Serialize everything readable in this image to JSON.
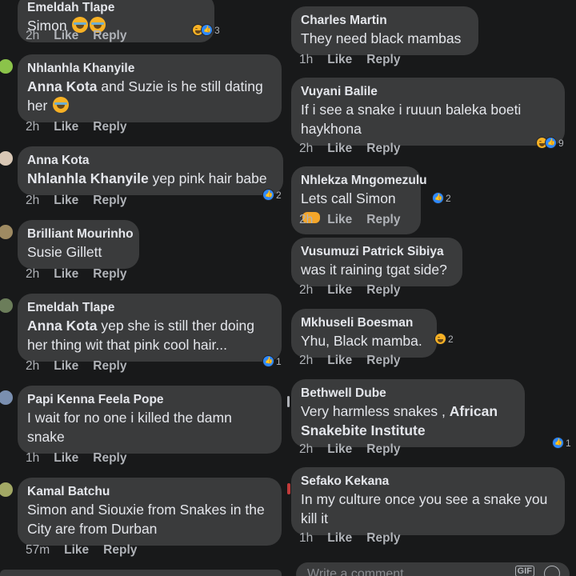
{
  "left": [
    {
      "author": "Emeldah Tlape",
      "segments": [
        {
          "t": "Simon ",
          "m": false
        }
      ],
      "emoji": "😂😂",
      "time": "2h",
      "like": "Like",
      "reply": "Reply",
      "react_count": "3",
      "react_types": [
        "haha",
        "like"
      ]
    },
    {
      "author": "Nhlanhla Khanyile",
      "segments": [
        {
          "t": "Anna Kota",
          "m": true
        },
        {
          "t": " and Suzie is he still dating her ",
          "m": false
        }
      ],
      "emoji": "😂",
      "time": "2h",
      "like": "Like",
      "reply": "Reply"
    },
    {
      "author": "Anna Kota",
      "segments": [
        {
          "t": "Nhlanhla Khanyile",
          "m": true
        },
        {
          "t": " yep pink hair babe",
          "m": false
        }
      ],
      "time": "2h",
      "like": "Like",
      "reply": "Reply",
      "react_count": "2",
      "react_types": [
        "like"
      ]
    },
    {
      "author": "Brilliant Mourinho",
      "segments": [
        {
          "t": "Susie Gillett",
          "m": false
        }
      ],
      "time": "2h",
      "like": "Like",
      "reply": "Reply"
    },
    {
      "author": "Emeldah Tlape",
      "segments": [
        {
          "t": "Anna Kota",
          "m": true
        },
        {
          "t": " yep she is still ther doing her thing wit that pink cool hair...",
          "m": false
        }
      ],
      "time": "2h",
      "like": "Like",
      "reply": "Reply",
      "react_count": "1",
      "react_types": [
        "like"
      ]
    },
    {
      "author": "Papi Kenna Feela Pope",
      "segments": [
        {
          "t": "I wait for no one i killed the damn snake",
          "m": false
        }
      ],
      "time": "1h",
      "like": "Like",
      "reply": "Reply"
    },
    {
      "author": "Kamal Batchu",
      "segments": [
        {
          "t": "Simon and Siouxie from Snakes in the City are from Durban",
          "m": false
        }
      ],
      "time": "57m",
      "like": "Like",
      "reply": "Reply"
    }
  ],
  "right": [
    {
      "author": "Charles Martin",
      "segments": [
        {
          "t": "They need black mambas",
          "m": false
        }
      ],
      "time": "1h",
      "like": "Like",
      "reply": "Reply"
    },
    {
      "author": "Vuyani Balile",
      "segments": [
        {
          "t": "If i see a snake i ruuun baleka boeti haykhona",
          "m": false
        }
      ],
      "time": "2h",
      "like": "Like",
      "reply": "Reply",
      "react_count": "9",
      "react_types": [
        "haha",
        "like"
      ]
    },
    {
      "author": "Nhlekza Mngomezulu",
      "segments": [
        {
          "t": "Lets call Simon ",
          "m": false
        }
      ],
      "hand": true,
      "time": "2h",
      "like": "Like",
      "reply": "Reply",
      "react_count": "2",
      "react_types": [
        "like"
      ]
    },
    {
      "author": "Vusumuzi Patrick Sibiya",
      "segments": [
        {
          "t": "was it raining tgat side?",
          "m": false
        }
      ],
      "time": "2h",
      "like": "Like",
      "reply": "Reply"
    },
    {
      "author": "Mkhuseli Boesman",
      "segments": [
        {
          "t": "Yhu, Black mamba.",
          "m": false
        }
      ],
      "time": "2h",
      "like": "Like",
      "reply": "Reply",
      "react_count": "2",
      "react_types": [
        "haha"
      ]
    },
    {
      "author": "Bethwell Dube",
      "segments": [
        {
          "t": "Very harmless snakes , ",
          "m": false
        },
        {
          "t": "African Snakebite Institute",
          "m": true
        }
      ],
      "time": "2h",
      "like": "Like",
      "reply": "Reply",
      "react_count": "1",
      "react_types": [
        "like"
      ]
    },
    {
      "author": "Sefako Kekana",
      "segments": [
        {
          "t": "In my culture once you see a snake you kill it",
          "m": false
        }
      ],
      "time": "1h",
      "like": "Like",
      "reply": "Reply"
    }
  ],
  "composer": {
    "placeholder": "Write a comment...",
    "gif": "GIF"
  },
  "colors": {
    "bg": "#18191a",
    "bubble": "#3a3b3c",
    "text": "#e4e6eb",
    "muted": "#b0b3b8",
    "like_blue": "#2e89ff",
    "haha_yellow": "#f7b125"
  }
}
